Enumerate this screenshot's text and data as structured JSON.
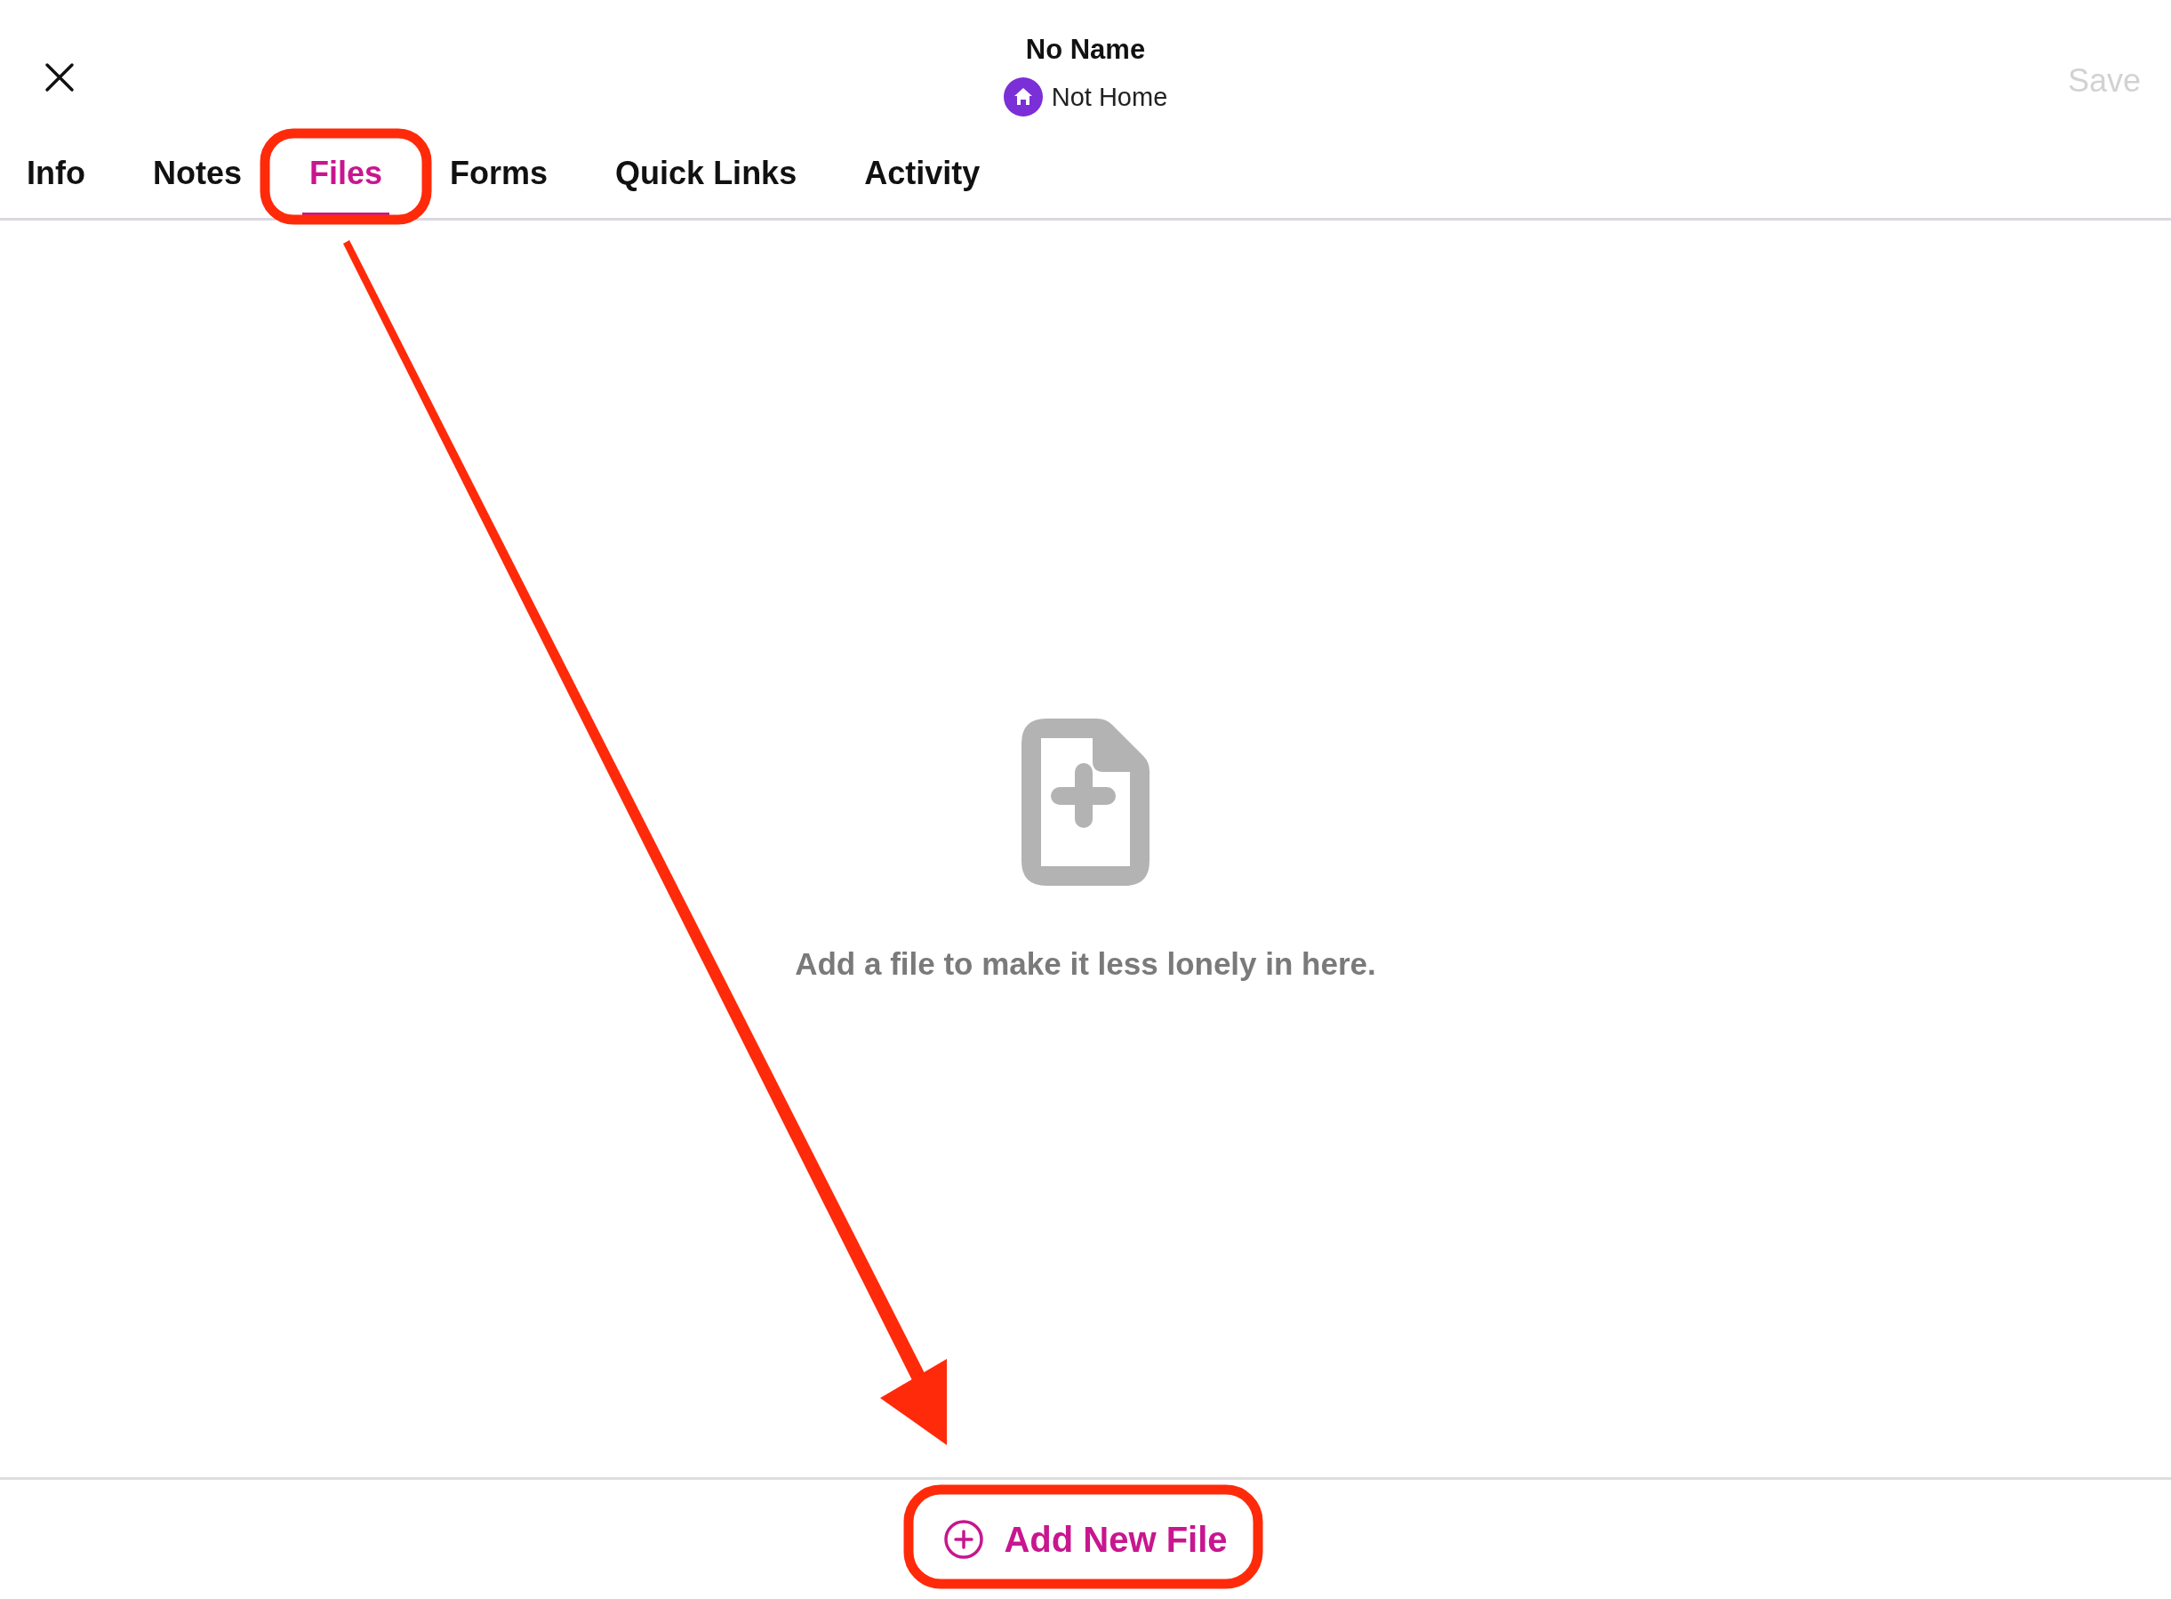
{
  "title": "No Name",
  "status": {
    "label": "Not Home"
  },
  "save": {
    "label": "Save",
    "disabled": true
  },
  "tabs": [
    {
      "label": "Info",
      "selected": false
    },
    {
      "label": "Notes",
      "selected": false
    },
    {
      "label": "Files",
      "selected": true
    },
    {
      "label": "Forms",
      "selected": false
    },
    {
      "label": "Quick Links",
      "selected": false
    },
    {
      "label": "Activity",
      "selected": false
    }
  ],
  "empty_state": {
    "message": "Add a file to make it less lonely in here."
  },
  "footer": {
    "button": "Add New File"
  }
}
